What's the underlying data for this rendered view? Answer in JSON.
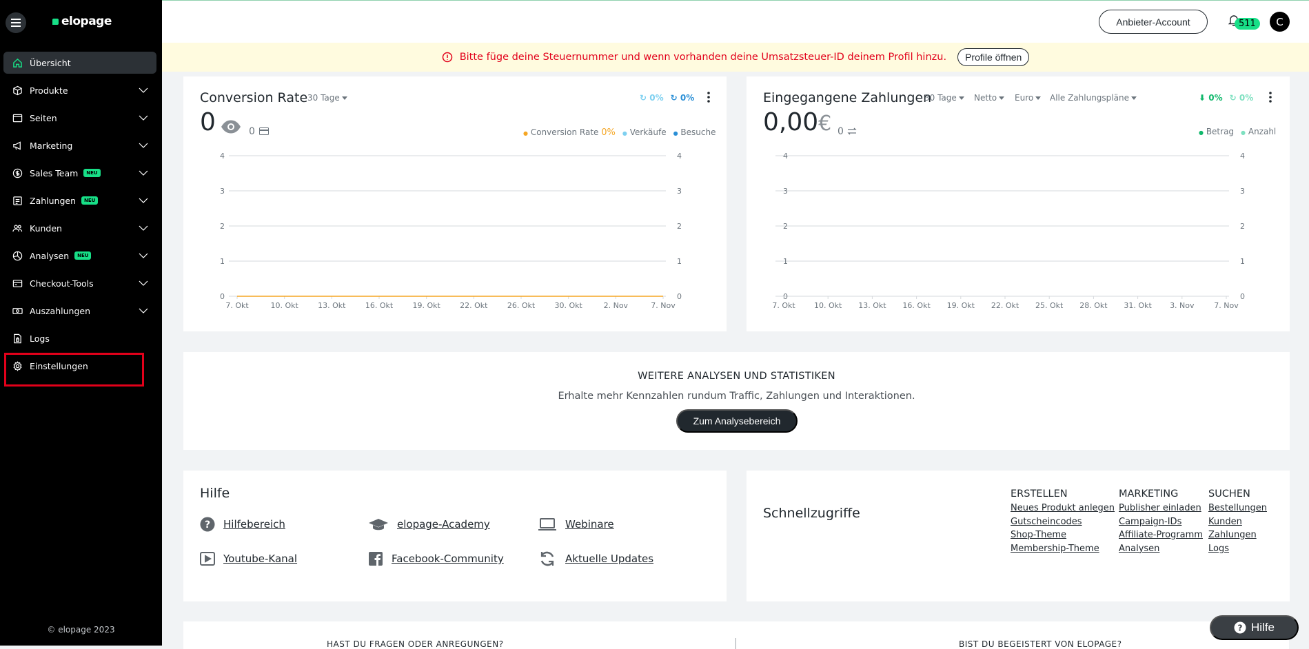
{
  "app": {
    "logo": "elopage",
    "copyright": "© elopage 2023"
  },
  "sidebar": {
    "items": [
      {
        "label": "Übersicht",
        "icon": "home-icon",
        "active": true
      },
      {
        "label": "Produkte",
        "icon": "box-icon",
        "chevron": true
      },
      {
        "label": "Seiten",
        "icon": "browser-icon",
        "chevron": true
      },
      {
        "label": "Marketing",
        "icon": "megaphone-icon",
        "chevron": true
      },
      {
        "label": "Sales Team",
        "icon": "dollar-circle-icon",
        "chevron": true,
        "badge": "NEU"
      },
      {
        "label": "Zahlungen",
        "icon": "receipt-icon",
        "chevron": true,
        "badge": "NEU"
      },
      {
        "label": "Kunden",
        "icon": "users-icon",
        "chevron": true
      },
      {
        "label": "Analysen",
        "icon": "chart-pie-icon",
        "chevron": true,
        "badge": "NEU"
      },
      {
        "label": "Checkout-Tools",
        "icon": "cart-icon",
        "chevron": true
      },
      {
        "label": "Auszahlungen",
        "icon": "money-icon",
        "chevron": true
      },
      {
        "label": "Logs",
        "icon": "file-lock-icon"
      },
      {
        "label": "Einstellungen",
        "icon": "gear-icon"
      }
    ]
  },
  "topbar": {
    "account_button": "Anbieter-Account",
    "notifications": "511",
    "avatar": "C"
  },
  "alert": {
    "text": "Bitte füge deine Steuernummer und wenn vorhanden deine Umsatzsteuer-ID deinem Profil hinzu.",
    "button": "Profile öffnen"
  },
  "conversion": {
    "title": "Conversion Rate",
    "period": "30 Tage",
    "big_value": "0",
    "secondary_value": "0",
    "pct1": "0%",
    "pct2": "0%",
    "legend": {
      "conversion": "Conversion Rate",
      "conversion_pct": "0%",
      "sales": "Verkäufe",
      "visits": "Besuche"
    }
  },
  "payments": {
    "title": "Eingegangene Zahlungen",
    "filters": [
      "30 Tage",
      "Netto",
      "Euro",
      "Alle Zahlungspläne"
    ],
    "big_value": "0,00",
    "currency": "€",
    "secondary_value": "0",
    "pct1": "0%",
    "pct2": "0%",
    "legend": {
      "amount": "Betrag",
      "count": "Anzahl"
    }
  },
  "chart_data": [
    {
      "type": "line",
      "x": [
        "7. Okt",
        "10. Okt",
        "13. Okt",
        "16. Okt",
        "19. Okt",
        "22. Okt",
        "26. Okt",
        "30. Okt",
        "2. Nov",
        "7. Nov"
      ],
      "yticks": [
        0,
        1,
        2,
        3,
        4
      ],
      "ylim": [
        0,
        4
      ],
      "series": [
        {
          "name": "Conversion Rate",
          "values": [
            0,
            0,
            0,
            0,
            0,
            0,
            0,
            0,
            0,
            0
          ],
          "color": "#f5a623"
        }
      ]
    },
    {
      "type": "line",
      "x": [
        "7. Okt",
        "10. Okt",
        "13. Okt",
        "16. Okt",
        "19. Okt",
        "22. Okt",
        "25. Okt",
        "28. Okt",
        "31. Okt",
        "3. Nov",
        "7. Nov"
      ],
      "yticks": [
        0,
        1,
        2,
        3,
        4
      ],
      "ylim": [
        0,
        4
      ],
      "series": []
    }
  ],
  "analytics": {
    "heading": "WEITERE ANALYSEN UND STATISTIKEN",
    "text": "Erhalte mehr Kennzahlen rundum Traffic, Zahlungen und Interaktionen.",
    "button": "Zum Analysebereich"
  },
  "help": {
    "title": "Hilfe",
    "links": [
      {
        "label": "Hilfebereich",
        "icon": "question-circle-icon"
      },
      {
        "label": "elopage-Academy",
        "icon": "graduation-cap-icon"
      },
      {
        "label": "Webinare",
        "icon": "laptop-icon"
      },
      {
        "label": "Youtube-Kanal",
        "icon": "youtube-icon"
      },
      {
        "label": "Facebook-Community",
        "icon": "facebook-icon"
      },
      {
        "label": "Aktuelle Updates",
        "icon": "refresh-icon"
      }
    ]
  },
  "quick": {
    "title": "Schnellzugriffe",
    "columns": [
      {
        "heading": "ERSTELLEN",
        "links": [
          "Neues Produkt anlegen",
          "Gutscheincodes",
          "Shop-Theme",
          "Membership-Theme"
        ]
      },
      {
        "heading": "MARKETING",
        "links": [
          "Publisher einladen",
          "Campaign-IDs",
          "Affiliate-Programm",
          "Analysen"
        ]
      },
      {
        "heading": "SUCHEN",
        "links": [
          "Bestellungen",
          "Kunden",
          "Zahlungen",
          "Logs"
        ]
      }
    ]
  },
  "bottom": {
    "left": "HAST DU FRAGEN ODER ANREGUNGEN?",
    "right": "BIST DU BEGEISTERT VON ELOPAGE?"
  },
  "float_help": "Hilfe",
  "colors": {
    "accent": "#17df87",
    "alert_red": "#e2001a",
    "sidebar_bg": "#000000",
    "conversion_line": "#f5a623"
  }
}
